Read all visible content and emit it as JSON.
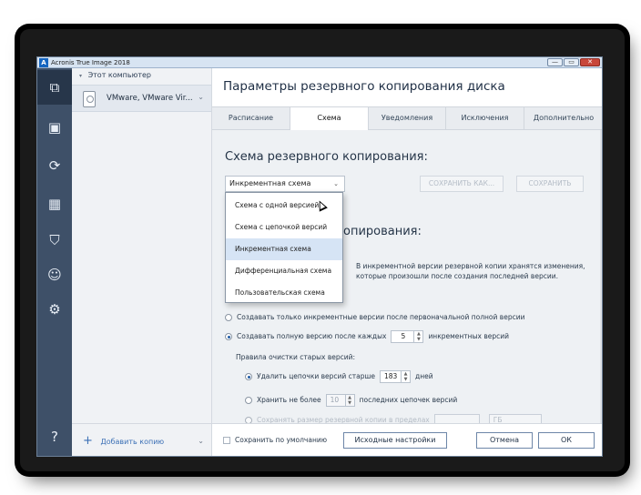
{
  "window": {
    "title": "Acronis True Image 2018",
    "buttons": [
      "—",
      "▭",
      "✕"
    ]
  },
  "rail": {
    "icons": [
      "backup-icon",
      "archive-icon",
      "sync-icon",
      "dashboard-icon",
      "protection-icon",
      "account-icon",
      "settings-icon",
      "help-icon"
    ]
  },
  "sources": {
    "header": "Этот компьютер",
    "item_label": "VMware, VMware Vir...",
    "add_copy": "Добавить копию"
  },
  "main": {
    "title": "Параметры резервного копирования диска",
    "tabs": [
      {
        "label": "Расписание"
      },
      {
        "label": "Схема"
      },
      {
        "label": "Уведомления"
      },
      {
        "label": "Исключения"
      },
      {
        "label": "Дополнительно"
      }
    ],
    "active_tab": "Схема"
  },
  "scheme": {
    "heading": "Схема резервного копирования:",
    "selected": "Инкрементная схема",
    "save_as": "СОХРАНИТЬ КАК...",
    "save": "СОХРАНИТЬ",
    "menu": [
      "Схема с одной версией",
      "Схема с цепочкой версий",
      "Инкрементная схема",
      "Дифференциальная схема",
      "Пользовательская схема"
    ],
    "menu_selected_index": 2
  },
  "method": {
    "heading_fragment": "опирования:",
    "description": "В инкрементной версии резервной копии хранятся изменения, которые произошли после создания последней версии."
  },
  "options": {
    "only_incremental": "Создавать только инкрементные версии после первоначальной полной версии",
    "full_every_prefix": "Создавать полную версию после каждых",
    "full_every_value": "5",
    "full_every_suffix": "инкрементных версий",
    "cleanup_label": "Правила очистки старых версий:",
    "delete_chains_prefix": "Удалить цепочки версий старше",
    "delete_chains_value": "183",
    "delete_chains_suffix": "дней",
    "keep_prefix": "Хранить не более",
    "keep_value": "10",
    "keep_suffix": "последних цепочек версий",
    "size_limit": "Сохранять размер резервной копии в пределах",
    "size_unit": "ГБ"
  },
  "footer": {
    "save_default": "Сохранить по умолчанию",
    "initial_settings": "Исходные настройки",
    "cancel": "Отмена",
    "ok": "ОК"
  }
}
